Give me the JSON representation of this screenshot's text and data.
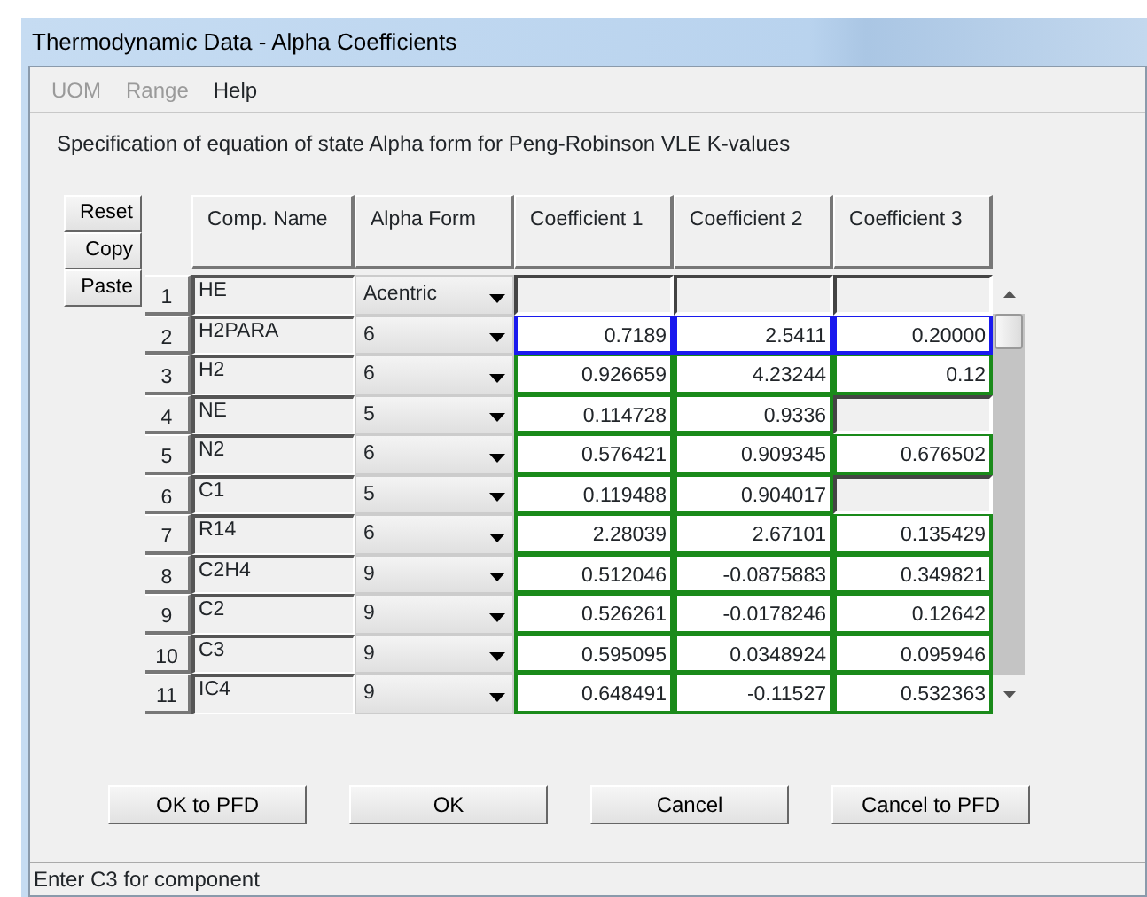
{
  "window": {
    "title": "Thermodynamic Data - Alpha Coefficients"
  },
  "menu": [
    {
      "label": "UOM",
      "disabled": true
    },
    {
      "label": "Range",
      "disabled": true
    },
    {
      "label": "Help",
      "disabled": false
    }
  ],
  "description": "Specification of equation of state Alpha form for Peng-Robinson VLE K-values",
  "side_buttons": [
    "Reset",
    "Copy",
    "Paste"
  ],
  "table": {
    "columns": [
      "Comp. Name",
      "Alpha Form",
      "Coefficient 1",
      "Coefficient 2",
      "Coefficient 3"
    ],
    "rows": [
      {
        "number": "1",
        "name": "HE",
        "alpha_form": "Acentric",
        "selected": false,
        "coefficients": [
          {
            "entered": false
          },
          {
            "entered": false
          },
          {
            "entered": false
          }
        ]
      },
      {
        "number": "2",
        "name": "H2PARA",
        "alpha_form": "6",
        "selected": true,
        "coefficients": [
          {
            "value": "0.7189",
            "entered": true
          },
          {
            "value": "2.5411",
            "entered": true
          },
          {
            "value": "0.20000",
            "entered": true
          }
        ]
      },
      {
        "number": "3",
        "name": "H2",
        "alpha_form": "6",
        "selected": false,
        "coefficients": [
          {
            "value": "0.926659",
            "entered": true
          },
          {
            "value": "4.23244",
            "entered": true
          },
          {
            "value": "0.12",
            "entered": true
          }
        ]
      },
      {
        "number": "4",
        "name": "NE",
        "alpha_form": "5",
        "selected": false,
        "coefficients": [
          {
            "value": "0.114728",
            "entered": true
          },
          {
            "value": "0.9336",
            "entered": true
          },
          {
            "entered": false
          }
        ]
      },
      {
        "number": "5",
        "name": "N2",
        "alpha_form": "6",
        "selected": false,
        "coefficients": [
          {
            "value": "0.576421",
            "entered": true
          },
          {
            "value": "0.909345",
            "entered": true
          },
          {
            "value": "0.676502",
            "entered": true
          }
        ]
      },
      {
        "number": "6",
        "name": "C1",
        "alpha_form": "5",
        "selected": false,
        "coefficients": [
          {
            "value": "0.119488",
            "entered": true
          },
          {
            "value": "0.904017",
            "entered": true
          },
          {
            "entered": false
          }
        ]
      },
      {
        "number": "7",
        "name": "R14",
        "alpha_form": "6",
        "selected": false,
        "coefficients": [
          {
            "value": "2.28039",
            "entered": true
          },
          {
            "value": "2.67101",
            "entered": true
          },
          {
            "value": "0.135429",
            "entered": true
          }
        ]
      },
      {
        "number": "8",
        "name": "C2H4",
        "alpha_form": "9",
        "selected": false,
        "coefficients": [
          {
            "value": "0.512046",
            "entered": true
          },
          {
            "value": "-0.0875883",
            "entered": true
          },
          {
            "value": "0.349821",
            "entered": true
          }
        ]
      },
      {
        "number": "9",
        "name": "C2",
        "alpha_form": "9",
        "selected": false,
        "coefficients": [
          {
            "value": "0.526261",
            "entered": true
          },
          {
            "value": "-0.0178246",
            "entered": true
          },
          {
            "value": "0.12642",
            "entered": true
          }
        ]
      },
      {
        "number": "10",
        "name": "C3",
        "alpha_form": "9",
        "selected": false,
        "coefficients": [
          {
            "value": "0.595095",
            "entered": true
          },
          {
            "value": "0.0348924",
            "entered": true
          },
          {
            "value": "0.095946",
            "entered": true
          }
        ]
      },
      {
        "number": "11",
        "name": "IC4",
        "alpha_form": "9",
        "selected": false,
        "coefficients": [
          {
            "value": "0.648491",
            "entered": true
          },
          {
            "value": "-0.11527",
            "entered": true
          },
          {
            "value": "0.532363",
            "entered": true
          }
        ]
      }
    ]
  },
  "buttons": [
    "OK to PFD",
    "OK",
    "Cancel",
    "Cancel to PFD"
  ],
  "status_bar": "Enter C3 for component"
}
